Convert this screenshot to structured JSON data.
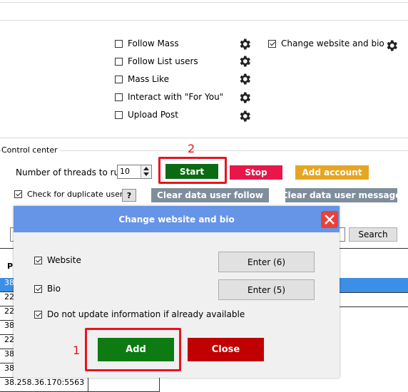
{
  "options": {
    "items": [
      {
        "label": "Follow Mass",
        "checked": false
      },
      {
        "label": "Follow List users",
        "checked": false
      },
      {
        "label": "Mass Like",
        "checked": false
      },
      {
        "label": "Interact with \"For You\"",
        "checked": false
      },
      {
        "label": "Upload Post",
        "checked": false
      }
    ],
    "change_website": {
      "label": "Change website and bio",
      "checked": true
    }
  },
  "control_center": {
    "title": "Control center",
    "threads_label": "Number of threads to run:",
    "threads_value": "10",
    "start": "Start",
    "stop": "Stop",
    "add_account": "Add account",
    "check_duplicate": "Check for duplicate users",
    "help": "?",
    "clear_follow": "Clear data user follow",
    "clear_message": "Clear data user message",
    "search": "Search"
  },
  "table": {
    "header_first": "P",
    "rows": [
      "38",
      "22",
      "22",
      "38",
      "22",
      "38",
      "38",
      "38"
    ],
    "last_row": "38.258.36.170:5563"
  },
  "dialog": {
    "title": "Change website and bio",
    "website_label": "Website",
    "website_checked": true,
    "website_button": "Enter (6)",
    "bio_label": "Bio",
    "bio_checked": true,
    "bio_button": "Enter (5)",
    "no_update_label": "Do not update information if already available",
    "no_update_checked": true,
    "add": "Add",
    "close": "Close"
  },
  "annotations": {
    "one": "1",
    "two": "2"
  },
  "colors": {
    "start_green": "#0b6b12",
    "add_green": "#0e7a12",
    "stop_red": "#e8174a",
    "close_red": "#c00000",
    "add_account_gold": "#e6a622",
    "clear_gray": "#7f8e9c",
    "dialog_title_blue": "#6694e6",
    "annotation_red": "#e8141d"
  }
}
